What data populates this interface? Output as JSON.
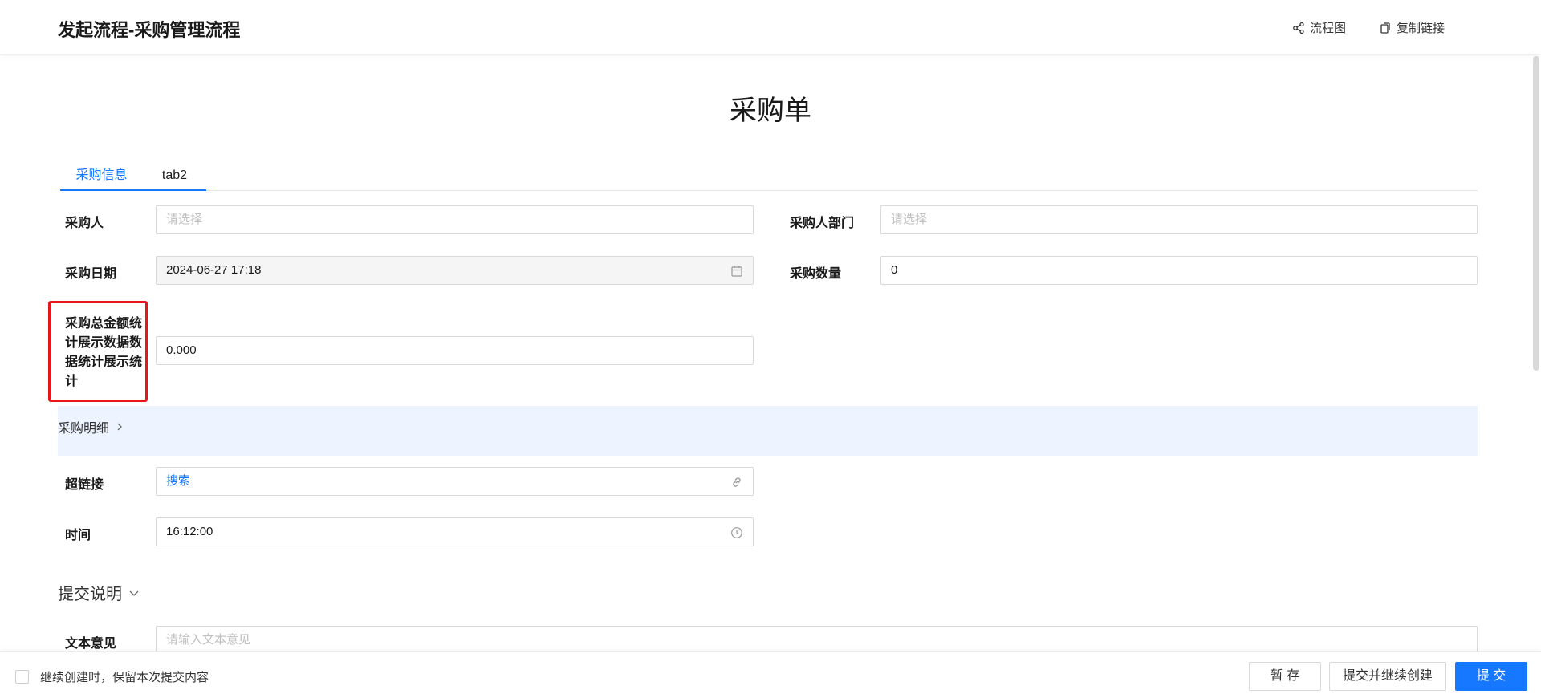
{
  "header": {
    "title": "发起流程-采购管理流程",
    "flow_chart_label": "流程图",
    "copy_link_label": "复制链接"
  },
  "form": {
    "title": "采购单",
    "tabs": [
      {
        "label": "采购信息",
        "active": true
      },
      {
        "label": "tab2",
        "active": false
      }
    ],
    "fields": {
      "purchaser": {
        "label": "采购人",
        "placeholder": "请选择"
      },
      "purchaser_dept": {
        "label": "采购人部门",
        "placeholder": "请选择"
      },
      "purchase_date": {
        "label": "采购日期",
        "value": "2024-06-27 17:18"
      },
      "purchase_qty": {
        "label": "采购数量",
        "value": "0"
      },
      "total_amount": {
        "label": "采购总金额统计展示数据数据统计展示统计",
        "value": "0.000"
      },
      "hyperlink": {
        "label": "超链接",
        "value": "搜索"
      },
      "time": {
        "label": "时间",
        "value": "16:12:00"
      },
      "text_opinion": {
        "label": "文本意见",
        "placeholder": "请输入文本意见"
      }
    },
    "detail_section": {
      "label": "采购明细"
    },
    "submit_section": {
      "label": "提交说明"
    }
  },
  "footer": {
    "keep_content_label": "继续创建时，保留本次提交内容",
    "keep_content_checked": false,
    "save_draft_label": "暂 存",
    "submit_continue_label": "提交并继续创建",
    "submit_label": "提 交"
  },
  "colors": {
    "primary": "#1677ff",
    "highlight_border": "#e8161b",
    "section_bg": "#edf3ff"
  }
}
